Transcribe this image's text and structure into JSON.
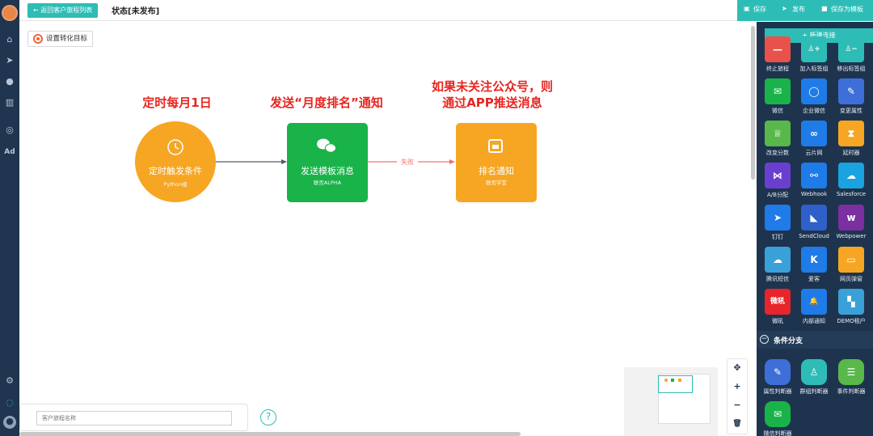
{
  "topbar": {
    "back_label": "← 返回客户旅程列表",
    "status": "状态[未发布]",
    "save_label": "保存",
    "publish_label": "发布",
    "save_template_label": "保存为模板"
  },
  "leftnav": {
    "ad_label": "Ad"
  },
  "canvas": {
    "goal_button": "设置转化目标",
    "annotations": [
      "定时每月1日",
      "发送“月度排名”通知",
      "如果未关注公众号，则通过APP推送消息"
    ],
    "nodes": [
      {
        "title": "定时触发条件",
        "sub": "Python组",
        "color": "#f6a623"
      },
      {
        "title": "发送模板消息",
        "sub": "联否ALPHA",
        "color": "#19b34a"
      },
      {
        "title": "排名通知",
        "sub": "联否学堂",
        "color": "#f6a623"
      }
    ],
    "edge_label": "失败",
    "name_placeholder": "客户旅程名称",
    "help": "?"
  },
  "zoom": {
    "locate": "✥",
    "in": "+",
    "out": "−",
    "delete": "🗑"
  },
  "panel": {
    "new_connection": "+ 新建连接",
    "tiles": [
      {
        "label": "终止旅程",
        "icon": "stop-icon",
        "color": "#e8524a",
        "glyph": "—"
      },
      {
        "label": "加入标签组",
        "icon": "add-user-icon",
        "color": "#2ebdb6",
        "glyph": "♙+"
      },
      {
        "label": "移出标签组",
        "icon": "remove-user-icon",
        "color": "#2ebdb6",
        "glyph": "♙−"
      },
      {
        "label": "微信",
        "icon": "wechat-icon",
        "color": "#19b34a",
        "glyph": "✉"
      },
      {
        "label": "企业微信",
        "icon": "work-wechat-icon",
        "color": "#1e7be8",
        "glyph": "◯"
      },
      {
        "label": "变更属性",
        "icon": "edit-icon",
        "color": "#3e6fd8",
        "glyph": "✎"
      },
      {
        "label": "改变分数",
        "icon": "trophy-icon",
        "color": "#58b84a",
        "glyph": "♕"
      },
      {
        "label": "云片网",
        "icon": "cloud-link-icon",
        "color": "#1e7be8",
        "glyph": "∞"
      },
      {
        "label": "延时器",
        "icon": "hourglass-icon",
        "color": "#f6a623",
        "glyph": "⧗"
      },
      {
        "label": "A/B分配",
        "icon": "split-icon",
        "color": "#6a3fd0",
        "glyph": "⋈"
      },
      {
        "label": "Webhook",
        "icon": "webhook-icon",
        "color": "#1e7be8",
        "glyph": "⚯"
      },
      {
        "label": "Salesforce",
        "icon": "salesforce-icon",
        "color": "#19a3df",
        "glyph": "☁"
      },
      {
        "label": "钉钉",
        "icon": "dingtalk-icon",
        "color": "#1e7be8",
        "glyph": "➤"
      },
      {
        "label": "SendCloud",
        "icon": "sendcloud-icon",
        "color": "#2f5fc8",
        "glyph": "◣"
      },
      {
        "label": "Webpower",
        "icon": "webpower-icon",
        "color": "#7b2fa0",
        "glyph": "w"
      },
      {
        "label": "腾讯短信",
        "icon": "tencent-sms-icon",
        "color": "#3aa0d8",
        "glyph": "☁"
      },
      {
        "label": "爱客",
        "icon": "aike-icon",
        "color": "#1e7be8",
        "glyph": "K"
      },
      {
        "label": "网页弹窗",
        "icon": "popup-icon",
        "color": "#f6a623",
        "glyph": "▭"
      },
      {
        "label": "微吼",
        "icon": "weihou-icon",
        "color": "#e8252a",
        "glyph": "微吼"
      },
      {
        "label": "内部通知",
        "icon": "bell-icon",
        "color": "#1e7be8",
        "glyph": "🔔"
      },
      {
        "label": "DEMO租户",
        "icon": "demo-tenant-icon",
        "color": "#3aa0d8",
        "glyph": "▚"
      }
    ],
    "branch_section": "条件分支",
    "branch_tiles": [
      {
        "label": "属性判断器",
        "icon": "attribute-judge-icon",
        "color": "#3e6fd8",
        "glyph": "✎"
      },
      {
        "label": "群组判断器",
        "icon": "group-judge-icon",
        "color": "#2ebdb6",
        "glyph": "♙"
      },
      {
        "label": "事件判断器",
        "icon": "event-judge-icon",
        "color": "#58b84a",
        "glyph": "☰"
      },
      {
        "label": "微信判断器",
        "icon": "wechat-judge-icon",
        "color": "#19b34a",
        "glyph": "✉"
      }
    ]
  }
}
